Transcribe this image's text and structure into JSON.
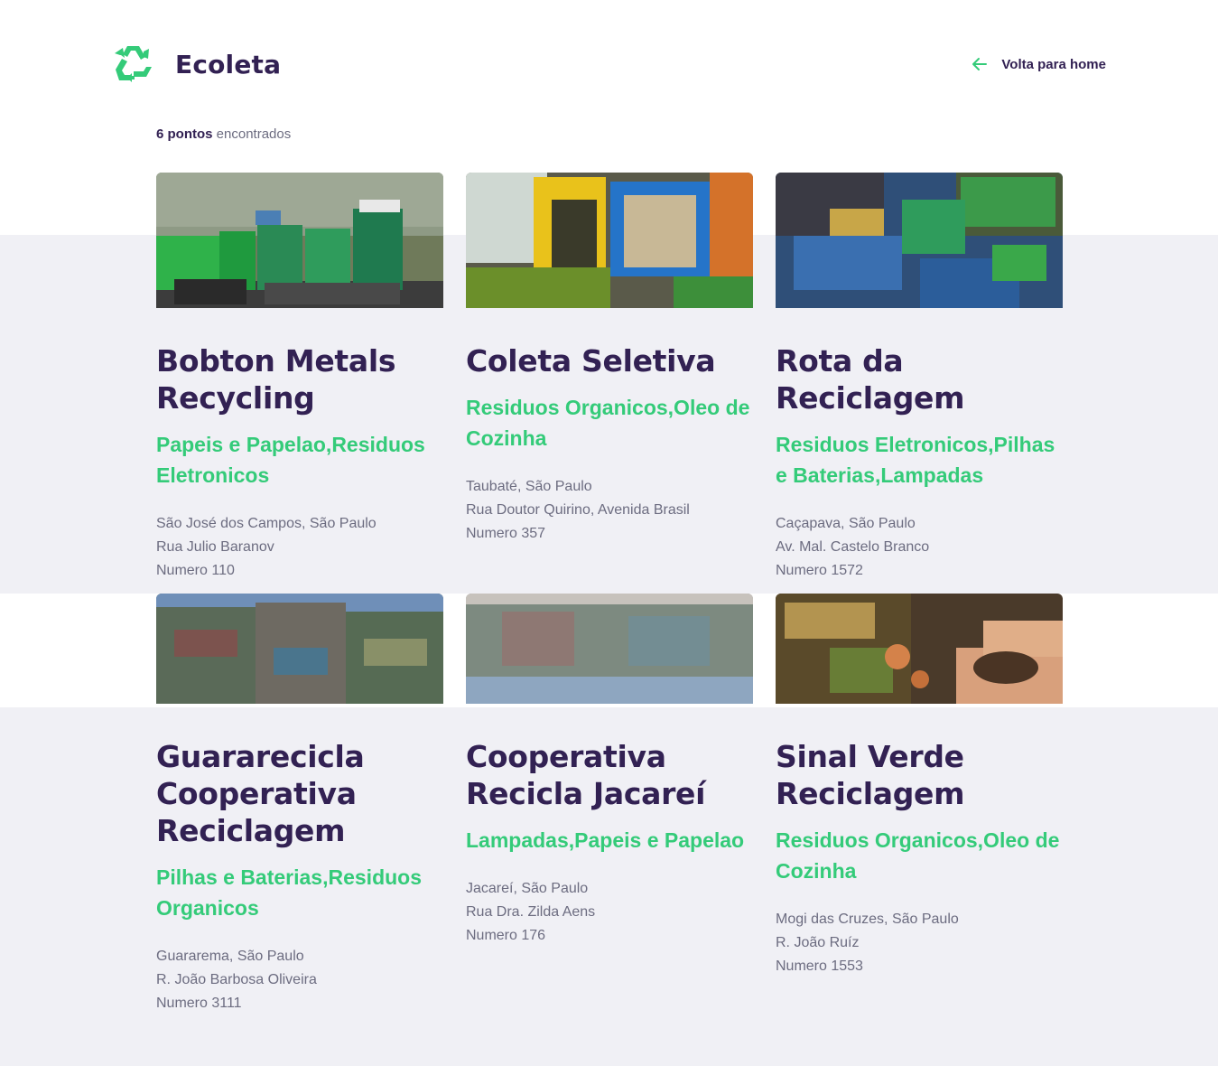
{
  "app": {
    "name": "Ecoleta"
  },
  "header": {
    "back_label": "Volta para home"
  },
  "results": {
    "count_strong": "6 pontos",
    "count_rest": " encontrados"
  },
  "colors": {
    "primary": "#322153",
    "accent": "#34cb79",
    "muted": "#6c6c80",
    "band": "#f0f0f5"
  },
  "points": [
    {
      "name": "Bobton Metals Recycling",
      "items": "Papeis e Papelao,Residuos Eletronicos",
      "city": "São José dos Campos, São Paulo",
      "street": "Rua Julio Baranov",
      "number": "Numero 110"
    },
    {
      "name": "Coleta Seletiva",
      "items": "Residuos Organicos,Oleo de Cozinha",
      "city": "Taubaté, São Paulo",
      "street": "Rua Doutor Quirino, Avenida Brasil",
      "number": "Numero 357"
    },
    {
      "name": "Rota da Reciclagem",
      "items": "Residuos Eletronicos,Pilhas e Baterias,Lampadas",
      "city": "Caçapava, São Paulo",
      "street": "Av. Mal. Castelo Branco",
      "number": "Numero 1572"
    },
    {
      "name": "Guararecicla Cooperativa Reciclagem",
      "items": "Pilhas e Baterias,Residuos Organicos",
      "city": "Guararema, São Paulo",
      "street": "R. João Barbosa Oliveira",
      "number": "Numero 3111"
    },
    {
      "name": "Cooperativa Recicla Jacareí",
      "items": "Lampadas,Papeis e Papelao",
      "city": "Jacareí, São Paulo",
      "street": "Rua Dra. Zilda Aens",
      "number": "Numero 176"
    },
    {
      "name": "Sinal Verde Reciclagem",
      "items": "Residuos Organicos,Oleo de Cozinha",
      "city": "Mogi das Cruzes, São Paulo",
      "street": "R. João Ruíz",
      "number": "Numero 1553"
    }
  ]
}
